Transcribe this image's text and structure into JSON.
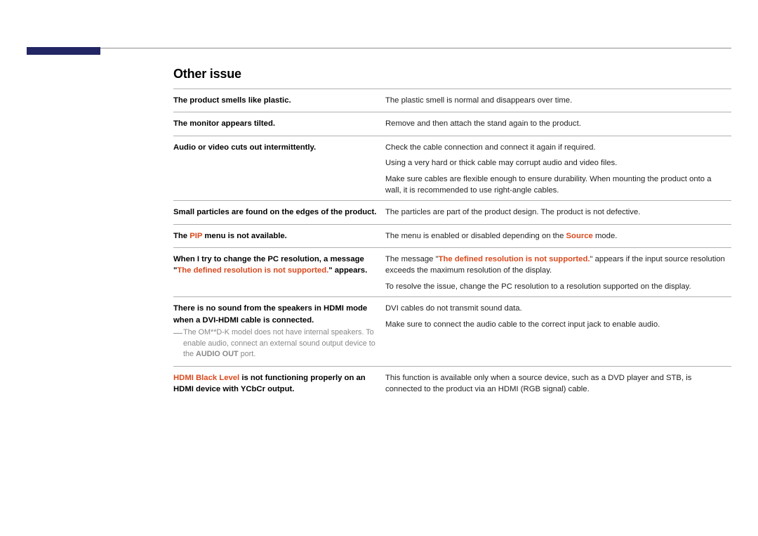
{
  "section_title": "Other issue",
  "rows": [
    {
      "left": [
        {
          "t": "The product smells like plastic."
        }
      ],
      "right": [
        [
          {
            "t": "The plastic smell is normal and disappears over time."
          }
        ]
      ]
    },
    {
      "left": [
        {
          "t": "The monitor appears tilted."
        }
      ],
      "right": [
        [
          {
            "t": "Remove and then attach the stand again to the product."
          }
        ]
      ]
    },
    {
      "left": [
        {
          "t": "Audio or video cuts out intermittently."
        }
      ],
      "right": [
        [
          {
            "t": "Check the cable connection and connect it again if required."
          }
        ],
        [
          {
            "t": "Using a very hard or thick cable may corrupt audio and video files."
          }
        ],
        [
          {
            "t": "Make sure cables are flexible enough to ensure durability. When mounting the product onto a wall, it is recommended to use right-angle cables."
          }
        ]
      ]
    },
    {
      "left": [
        {
          "t": "Small particles are found on the edges of the product."
        }
      ],
      "right": [
        [
          {
            "t": "The particles are part of the product design. The product is not defective."
          }
        ]
      ]
    },
    {
      "left": [
        {
          "t": "The "
        },
        {
          "t": "PIP",
          "hl": true
        },
        {
          "t": " menu is not available."
        }
      ],
      "right": [
        [
          {
            "t": "The menu is enabled or disabled depending on the "
          },
          {
            "t": "Source",
            "hl": true
          },
          {
            "t": " mode."
          }
        ]
      ]
    },
    {
      "left": [
        {
          "t": "When I try to change the PC resolution, a message \""
        },
        {
          "t": "The defined resolution is not supported.",
          "hl": true
        },
        {
          "t": "\" appears."
        }
      ],
      "right": [
        [
          {
            "t": "The message \""
          },
          {
            "t": "The defined resolution is not supported.",
            "hl": true
          },
          {
            "t": "\" appears if the input source resolution exceeds the maximum resolution of the display."
          }
        ],
        [
          {
            "t": "To resolve the issue, change the PC resolution to a resolution supported on the display."
          }
        ]
      ]
    },
    {
      "left": [
        {
          "t": "There is no sound from the speakers in HDMI mode when a DVI-HDMI cable is connected."
        }
      ],
      "note": {
        "pre": "The OM**D-K model does not have internal speakers. To enable audio, connect an external sound output device to the ",
        "bold": "AUDIO OUT",
        "post": " port."
      },
      "right": [
        [
          {
            "t": "DVI cables do not transmit sound data."
          }
        ],
        [
          {
            "t": "Make sure to connect the audio cable to the correct input jack to enable audio."
          }
        ]
      ]
    },
    {
      "left": [
        {
          "t": "HDMI Black Level",
          "hl": true
        },
        {
          "t": " is not functioning properly on an HDMI device with YCbCr output."
        }
      ],
      "right": [
        [
          {
            "t": "This function is available only when a source device, such as a DVD player and STB, is connected to the product via an HDMI (RGB signal) cable."
          }
        ]
      ]
    }
  ]
}
